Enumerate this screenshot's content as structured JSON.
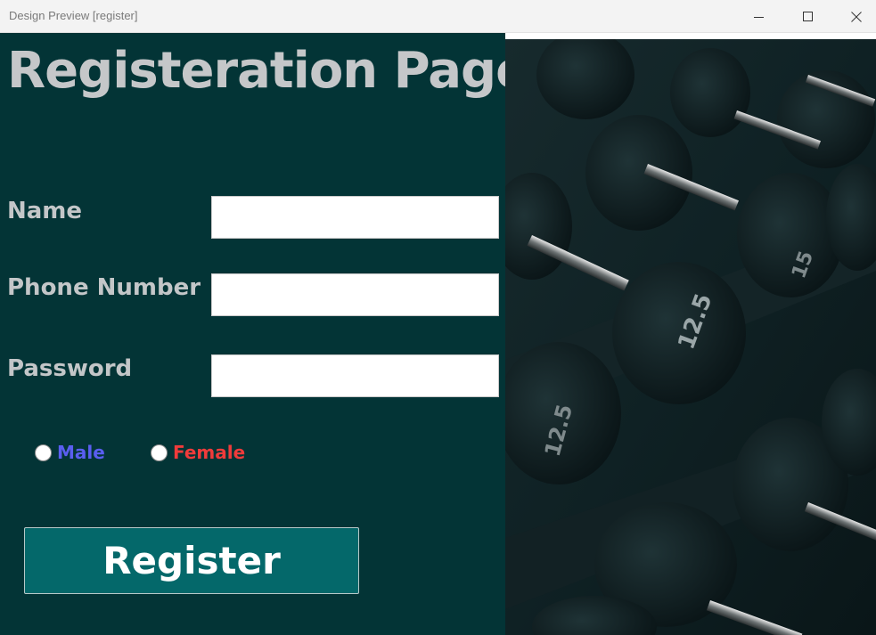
{
  "window": {
    "title": "Design Preview [register]"
  },
  "form": {
    "title": "Registeration Page",
    "fields": {
      "name": {
        "label": "Name",
        "value": ""
      },
      "phone": {
        "label": "Phone Number",
        "value": ""
      },
      "password": {
        "label": "Password",
        "value": ""
      }
    },
    "gender": {
      "male": {
        "label": "Male",
        "selected": false
      },
      "female": {
        "label": "Female",
        "selected": false
      }
    },
    "register_label": "Register"
  },
  "colors": {
    "panel_background": "#033436",
    "label_text": "#c3c6c8",
    "male_label": "#5a5ef0",
    "female_label": "#f03b3b",
    "button_background": "#04686a"
  },
  "image": {
    "subject": "dumbbells-rack-photo"
  }
}
